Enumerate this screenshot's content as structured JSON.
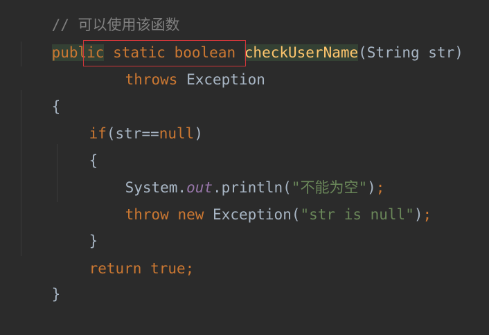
{
  "code": {
    "line0_comment": "// 可以使用该函数",
    "line1_public": "public",
    "line1_static": "static",
    "line1_boolean": "boolean",
    "line1_method": "checkUserName",
    "line1_params": "(String str)",
    "line2_throws": "throws",
    "line2_exception": "Exception",
    "line3_brace": "{",
    "line4_if": "if",
    "line4_cond_open": "(str==",
    "line4_null": "null",
    "line4_cond_close": ")",
    "line5_brace": "{",
    "line6_system": "System.",
    "line6_out": "out",
    "line6_println": ".println(",
    "line6_string": "\"不能为空\"",
    "line6_close": ")",
    "line6_semicolon": ";",
    "line7_throw": "throw",
    "line7_new": "new",
    "line7_exception": "Exception(",
    "line7_string": "\"str is null\"",
    "line7_close": ")",
    "line7_semicolon": ";",
    "line8_brace": "}",
    "line9_return": "return",
    "line9_true": "true",
    "line9_semicolon": ";",
    "line10_brace": "}"
  },
  "colors": {
    "background": "#2b2b2b",
    "keyword": "#cc7832",
    "method": "#ffc66d",
    "string": "#6a8759",
    "field": "#9876aa",
    "text": "#a9b7c6",
    "highlight_box": "#d0363a"
  }
}
